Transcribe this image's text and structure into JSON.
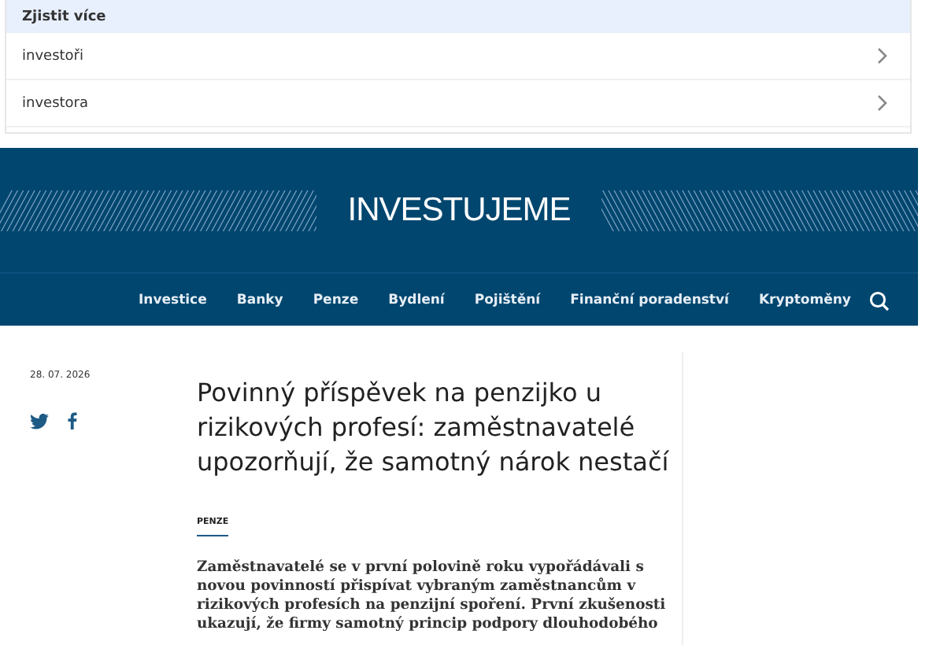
{
  "related": {
    "title": "Zjistit více",
    "items": [
      {
        "label": "investoři"
      },
      {
        "label": "investora"
      }
    ]
  },
  "header": {
    "logo": "INVESTUJEME",
    "nav": [
      {
        "label": "Investice"
      },
      {
        "label": "Banky"
      },
      {
        "label": "Penze"
      },
      {
        "label": "Bydlení"
      },
      {
        "label": "Pojištění"
      },
      {
        "label": "Finanční poradenství"
      },
      {
        "label": "Kryptoměny"
      }
    ]
  },
  "article": {
    "date": "28. 07. 2026",
    "title": "Povinný příspěvek na penzijko u rizikových profesí: zaměstnavatelé upozorňují, že samotný nárok nestačí",
    "category": "PENZE",
    "lead": "Zaměstnavatelé se v první polovině roku vypořádávali s novou povinností přispívat vybraným zaměstnancům v rizikových profesích na penzijní spoření. První zkušenosti ukazují, že firmy samotný princip podpory dlouhodobého"
  }
}
